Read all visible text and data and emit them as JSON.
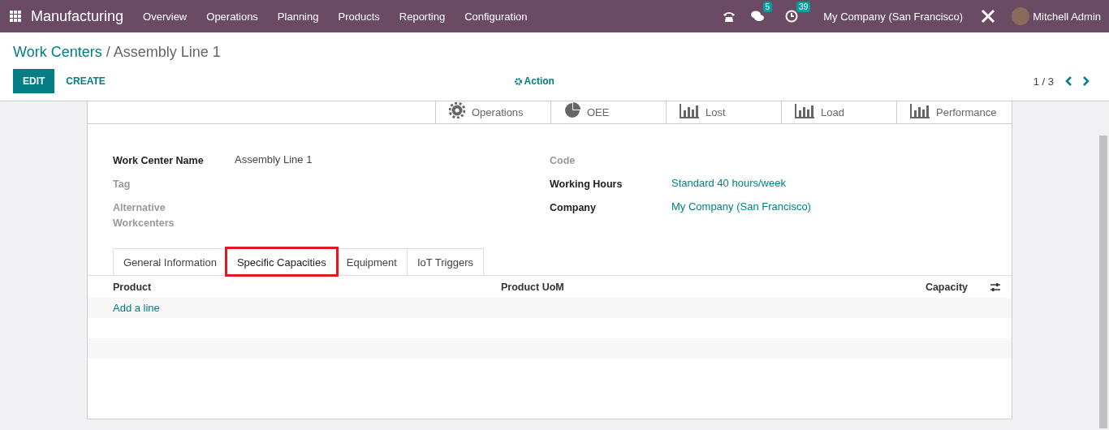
{
  "navbar": {
    "app_name": "Manufacturing",
    "menu": [
      "Overview",
      "Operations",
      "Planning",
      "Products",
      "Reporting",
      "Configuration"
    ],
    "messages_count": "5",
    "activities_count": "39",
    "company": "My Company (San Francisco)",
    "user": "Mitchell Admin"
  },
  "breadcrumb": {
    "parent": "Work Centers",
    "separator": "/",
    "current": "Assembly Line 1"
  },
  "buttons": {
    "edit": "EDIT",
    "create": "CREATE",
    "action": "Action"
  },
  "pager": {
    "text": "1 / 3"
  },
  "stat_buttons": [
    {
      "kind": "gear",
      "label": "Operations"
    },
    {
      "kind": "pie",
      "label": "OEE"
    },
    {
      "kind": "bars",
      "label": "Lost"
    },
    {
      "kind": "bars",
      "label": "Load"
    },
    {
      "kind": "bars",
      "label": "Performance"
    }
  ],
  "left_fields": [
    {
      "label": "Work Center Name",
      "value": "Assembly Line 1",
      "required": true
    },
    {
      "label": "Tag",
      "required": false
    },
    {
      "label": "Alternative Workcenters",
      "required": false
    }
  ],
  "right_fields": [
    {
      "label": "Code",
      "required": false
    },
    {
      "label": "Working Hours",
      "value": "Standard 40 hours/week",
      "required": true
    },
    {
      "label": "Company",
      "value": "My Company (San Francisco)",
      "required": true
    }
  ],
  "tabs": [
    {
      "label": "General Information",
      "selected": false,
      "highlighted": false
    },
    {
      "label": "Specific Capacities",
      "selected": true,
      "highlighted": true
    },
    {
      "label": "Equipment",
      "selected": false,
      "highlighted": false
    },
    {
      "label": "IoT Triggers",
      "selected": false,
      "highlighted": false
    }
  ],
  "table": {
    "columns": [
      "Product",
      "Product UoM",
      "Capacity"
    ],
    "add_line": "Add a line"
  }
}
